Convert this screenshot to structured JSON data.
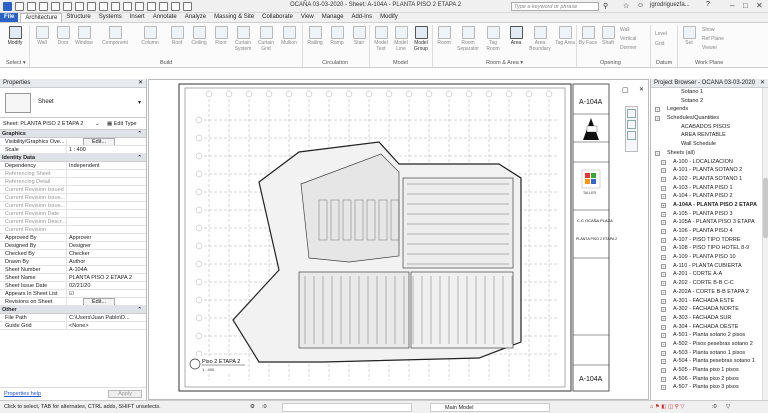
{
  "window": {
    "title": "OCAÑA 03-03-2020 - Sheet: A-104A - PLANTA PISO 2 ETAPA 2",
    "search_placeholder": "Type a keyword or phrase",
    "user": "jgrodriguezfa..."
  },
  "tabs": [
    "File",
    "Architecture",
    "Structure",
    "Systems",
    "Insert",
    "Annotate",
    "Analyze",
    "Massing & Site",
    "Collaborate",
    "View",
    "Manage",
    "Add-Ins",
    "Modify"
  ],
  "ribbon": {
    "buttons": [
      "Modify",
      "Wall",
      "Door",
      "Window",
      "Component",
      "Column",
      "Roof",
      "Ceiling",
      "Floor",
      "Curtain System",
      "Curtain Grid",
      "Mullion",
      "Railing",
      "Ramp",
      "Stair",
      "Model Text",
      "Model Line",
      "Model Group",
      "Room",
      "Room Separator",
      "Tag Room",
      "Area",
      "Area Boundary",
      "Tag Area",
      "By Face",
      "Shaft",
      "Wall",
      "Vertical",
      "Dormer",
      "Level",
      "Grid",
      "Set",
      "Ref Plane",
      "Show",
      "Viewer"
    ],
    "groups": [
      "Select",
      "Build",
      "Circulation",
      "Model",
      "Room & Area",
      "Opening",
      "Datum",
      "Work Plane"
    ]
  },
  "properties": {
    "title": "Properties",
    "type_name": "Sheet",
    "instance_selector": "Sheet: PLANTA PISO 2 ETAPA 2",
    "edit_type": "Edit Type",
    "sections": [
      {
        "name": "Graphics",
        "rows": [
          {
            "k": "Visibility/Graphics Ove...",
            "v": "Edit..."
          },
          {
            "k": "Scale",
            "v": "1 : 400"
          }
        ]
      },
      {
        "name": "Identity Data",
        "rows": [
          {
            "k": "Dependency",
            "v": "Independent"
          },
          {
            "k": "Referencing Sheet",
            "v": ""
          },
          {
            "k": "Referencing Detail",
            "v": ""
          },
          {
            "k": "Current Revision Issued",
            "v": ""
          },
          {
            "k": "Current Revision Issue...",
            "v": ""
          },
          {
            "k": "Current Revision Issue...",
            "v": ""
          },
          {
            "k": "Current Revision Date",
            "v": ""
          },
          {
            "k": "Current Revision Descr...",
            "v": ""
          },
          {
            "k": "Current Revision",
            "v": ""
          },
          {
            "k": "Approved By",
            "v": "Approver"
          },
          {
            "k": "Designed By",
            "v": "Designer"
          },
          {
            "k": "Checked By",
            "v": "Checker"
          },
          {
            "k": "Drawn By",
            "v": "Author"
          },
          {
            "k": "Sheet Number",
            "v": "A-104A"
          },
          {
            "k": "Sheet Name",
            "v": "PLANTA PISO 2 ETAPA 2"
          },
          {
            "k": "Sheet Issue Date",
            "v": "02/21/20"
          },
          {
            "k": "Appears In Sheet List",
            "v": "☑"
          },
          {
            "k": "Revisions on Sheet",
            "v": "Edit..."
          }
        ]
      },
      {
        "name": "Other",
        "rows": [
          {
            "k": "File Path",
            "v": "C:\\Users\\Juan Pablo\\D..."
          },
          {
            "k": "Guide Grid",
            "v": "<None>"
          }
        ]
      }
    ],
    "help_link": "Properties help",
    "apply": "Apply"
  },
  "sheet": {
    "view_title": "Piso 2 ETAPA 2",
    "view_scale": "1 : 400",
    "sheet_number": "A-104A",
    "project_name": "C.C OCAÑA PLAZA",
    "sheet_name": "PLANTA PISO 2 ETAPA 2",
    "logo_text": "TALLER"
  },
  "browser": {
    "title": "Project Browser - OCAÑA 03-03-2020",
    "items": [
      {
        "t": "Sotano 1",
        "lvl": 2
      },
      {
        "t": "Sotano 2",
        "lvl": 2
      },
      {
        "t": "Legends",
        "lvl": 0
      },
      {
        "t": "Schedules/Quantities",
        "lvl": 0
      },
      {
        "t": "ACABADOS PISOS",
        "lvl": 2
      },
      {
        "t": "AREA RENTABLE",
        "lvl": 2
      },
      {
        "t": "Wall Schedule",
        "lvl": 2
      },
      {
        "t": "Sheets (all)",
        "lvl": 0
      },
      {
        "t": "A-100 - LOCALIZACION",
        "lvl": 1
      },
      {
        "t": "A-101 - PLANTA SOTANO 2",
        "lvl": 1
      },
      {
        "t": "A-102 - PLANTA SOTANO 1",
        "lvl": 1
      },
      {
        "t": "A-103 - PLANTA PISO 1",
        "lvl": 1
      },
      {
        "t": "A-104 - PLANTA PISO 2",
        "lvl": 1
      },
      {
        "t": "A-104A - PLANTA PISO 2 ETAPA",
        "lvl": 1,
        "sel": true
      },
      {
        "t": "A-105 - PLANTA PISO 3",
        "lvl": 1
      },
      {
        "t": "A-105A - PLANTA PISO 3 ETAPA",
        "lvl": 1
      },
      {
        "t": "A-106 - PLANTA PISO 4",
        "lvl": 1
      },
      {
        "t": "A-107 - PISO TIPO TORRE",
        "lvl": 1
      },
      {
        "t": "A-108 - PISO TIPO HOTEL 8-9",
        "lvl": 1
      },
      {
        "t": "A-109 - PLANTA PISO 10",
        "lvl": 1
      },
      {
        "t": "A-110 - PLANTA CUBIERTA",
        "lvl": 1
      },
      {
        "t": "A-201 - CORTE A-A",
        "lvl": 1
      },
      {
        "t": "A-202 - CORTE B-B C-C",
        "lvl": 1
      },
      {
        "t": "A-202A - CORTE B-B ETAPA 2",
        "lvl": 1
      },
      {
        "t": "A-301 - FACHADA ESTE",
        "lvl": 1
      },
      {
        "t": "A-302 - FACHADA NORTE",
        "lvl": 1
      },
      {
        "t": "A-303 - FACHADA SUR",
        "lvl": 1
      },
      {
        "t": "A-304 - FACHADA OESTE",
        "lvl": 1
      },
      {
        "t": "A-501 - Planta sotano 2 pisos",
        "lvl": 1
      },
      {
        "t": "A-502 - Pisos pesebras sotano 2",
        "lvl": 1
      },
      {
        "t": "A-503 - Planta sotano 1 pisos",
        "lvl": 1
      },
      {
        "t": "A-504 - Planta pesebras sotano 1",
        "lvl": 1
      },
      {
        "t": "A-505 - Planta piso 1 pisos",
        "lvl": 1
      },
      {
        "t": "A-506 - Planta piso 2 pisos",
        "lvl": 1
      },
      {
        "t": "A-507 - Planta piso 3 pisos",
        "lvl": 1
      }
    ]
  },
  "status": {
    "message": "Click to select, TAB for alternates, CTRL adds, SHIFT unselects.",
    "model": "Main Model",
    "zero": ":0"
  }
}
